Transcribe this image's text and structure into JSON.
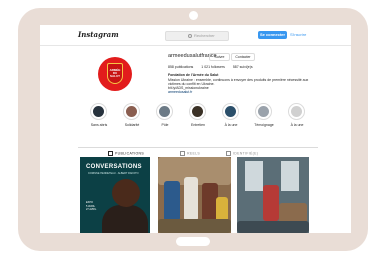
{
  "topbar": {
    "logo": "Instagram",
    "search_placeholder": "Rechercher",
    "login_label": "Se connecter",
    "signup_label": "S'inscrire"
  },
  "profile": {
    "username": "armeedusalutfrance",
    "follow_label": "Suivre",
    "contact_label": "Contacter",
    "stats": [
      "858 publications",
      "1 021 followers",
      "587 suivi(e)s"
    ],
    "bio_name": "Fondation de l'Armée du Salut",
    "bio_lines": [
      "Mission Ukraine : ensemble, continuons à envoyer des produits de première nécessité aux",
      "victimes du conflit en Ukraine.",
      "bit.ly/ADS_missionukraine"
    ],
    "bio_link": "armeedusalut.fr"
  },
  "highlights": [
    {
      "label": "Sans abris",
      "color": "#27323d"
    },
    {
      "label": "Solidarité",
      "color": "#8a5e50"
    },
    {
      "label": "Pôle",
      "color": "#6c7a86"
    },
    {
      "label": "Entretien",
      "color": "#3b3126"
    },
    {
      "label": "À la une",
      "color": "#2b4f6a"
    },
    {
      "label": "Témoignage",
      "color": "#9aa2ab"
    },
    {
      "label": "À la une",
      "color": "#d0d0d0"
    }
  ],
  "tabs": [
    "PUBLICATIONS",
    "REELS",
    "IDENTIFIÉ(E)"
  ],
  "posts": {
    "first": {
      "title": "CONVERSATIONS",
      "subtitle": "CORINNE HENNETEAU · ALBERT RAKOTO",
      "side_lines": [
        "EXPO",
        "5 AVRIL",
        "27 AVRIL"
      ]
    }
  }
}
